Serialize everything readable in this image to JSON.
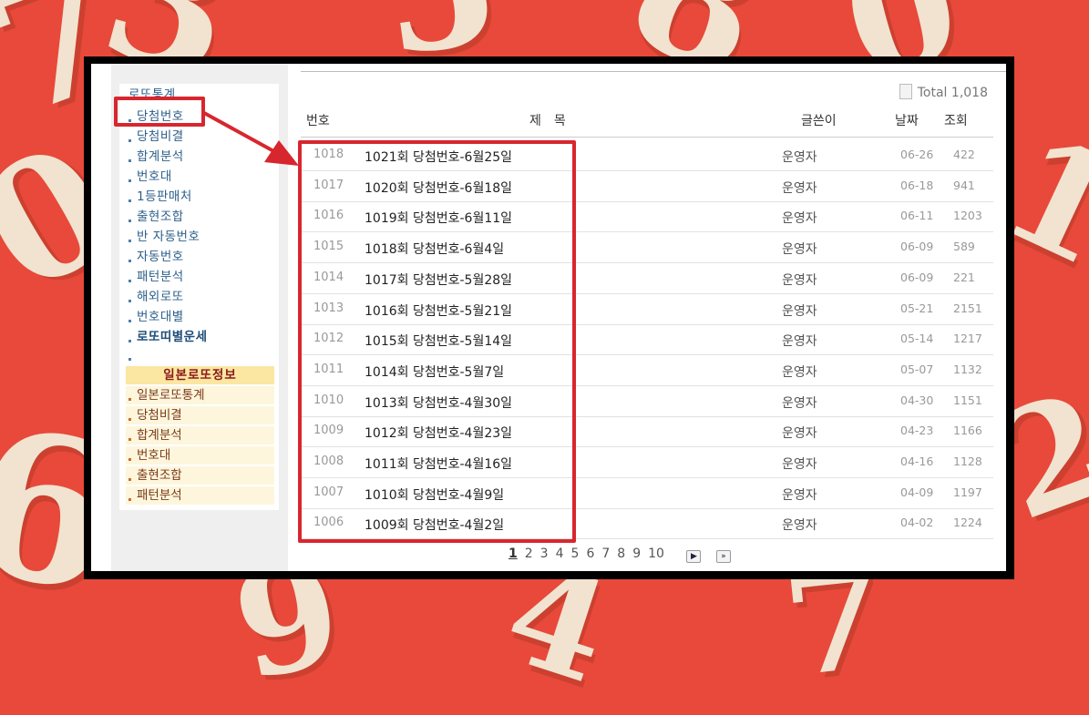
{
  "sidebar": {
    "items": [
      {
        "label": "로또통계",
        "bullet": false,
        "bold": false
      },
      {
        "label": "당첨번호",
        "bullet": true,
        "bold": false
      },
      {
        "label": "당첨비결",
        "bullet": true,
        "bold": false
      },
      {
        "label": "합계분석",
        "bullet": true,
        "bold": false
      },
      {
        "label": "번호대",
        "bullet": true,
        "bold": false
      },
      {
        "label": "1등판매처",
        "bullet": true,
        "bold": false
      },
      {
        "label": "출현조합",
        "bullet": true,
        "bold": false
      },
      {
        "label": "반 자동번호",
        "bullet": true,
        "bold": false
      },
      {
        "label": "자동번호",
        "bullet": true,
        "bold": false
      },
      {
        "label": "패턴분석",
        "bullet": true,
        "bold": false
      },
      {
        "label": "해외로또",
        "bullet": true,
        "bold": false
      },
      {
        "label": "번호대별",
        "bullet": true,
        "bold": false
      },
      {
        "label": "로또띠별운세",
        "bullet": true,
        "bold": true
      }
    ],
    "japan_header": "일본로또정보",
    "japan_items": [
      "일본로또통계",
      "당첨비결",
      "합계분석",
      "번호대",
      "출현조합",
      "패턴분석"
    ]
  },
  "board": {
    "total_label": "Total",
    "total_value": "1,018",
    "headers": {
      "num": "번호",
      "title": "제　목",
      "author": "글쓴이",
      "date": "날짜",
      "views": "조회"
    },
    "rows": [
      {
        "num": "1018",
        "title": "1021회 당첨번호-6월25일",
        "author": "운영자",
        "date": "06-26",
        "views": "422"
      },
      {
        "num": "1017",
        "title": "1020회 당첨번호-6월18일",
        "author": "운영자",
        "date": "06-18",
        "views": "941"
      },
      {
        "num": "1016",
        "title": "1019회 당첨번호-6월11일",
        "author": "운영자",
        "date": "06-11",
        "views": "1203"
      },
      {
        "num": "1015",
        "title": "1018회 당첨번호-6월4일",
        "author": "운영자",
        "date": "06-09",
        "views": "589"
      },
      {
        "num": "1014",
        "title": "1017회 당첨번호-5월28일",
        "author": "운영자",
        "date": "06-09",
        "views": "221"
      },
      {
        "num": "1013",
        "title": "1016회 당첨번호-5월21일",
        "author": "운영자",
        "date": "05-21",
        "views": "2151"
      },
      {
        "num": "1012",
        "title": "1015회 당첨번호-5월14일",
        "author": "운영자",
        "date": "05-14",
        "views": "1217"
      },
      {
        "num": "1011",
        "title": "1014회 당첨번호-5월7일",
        "author": "운영자",
        "date": "05-07",
        "views": "1132"
      },
      {
        "num": "1010",
        "title": "1013회 당첨번호-4월30일",
        "author": "운영자",
        "date": "04-30",
        "views": "1151"
      },
      {
        "num": "1009",
        "title": "1012회 당첨번호-4월23일",
        "author": "운영자",
        "date": "04-23",
        "views": "1166"
      },
      {
        "num": "1008",
        "title": "1011회 당첨번호-4월16일",
        "author": "운영자",
        "date": "04-16",
        "views": "1128"
      },
      {
        "num": "1007",
        "title": "1010회 당첨번호-4월9일",
        "author": "운영자",
        "date": "04-09",
        "views": "1197"
      },
      {
        "num": "1006",
        "title": "1009회 당첨번호-4월2일",
        "author": "운영자",
        "date": "04-02",
        "views": "1224"
      }
    ]
  },
  "pagination": {
    "pages": [
      "1",
      "2",
      "3",
      "4",
      "5",
      "6",
      "7",
      "8",
      "9",
      "10"
    ],
    "current": "1",
    "next_icon": "chevron-right-icon",
    "last_icon": "double-chevron-right-icon"
  },
  "colors": {
    "background": "#e8493a",
    "highlight": "#d8262e",
    "link": "#2c5f8a",
    "japan_header_bg": "#fbe6a2"
  }
}
